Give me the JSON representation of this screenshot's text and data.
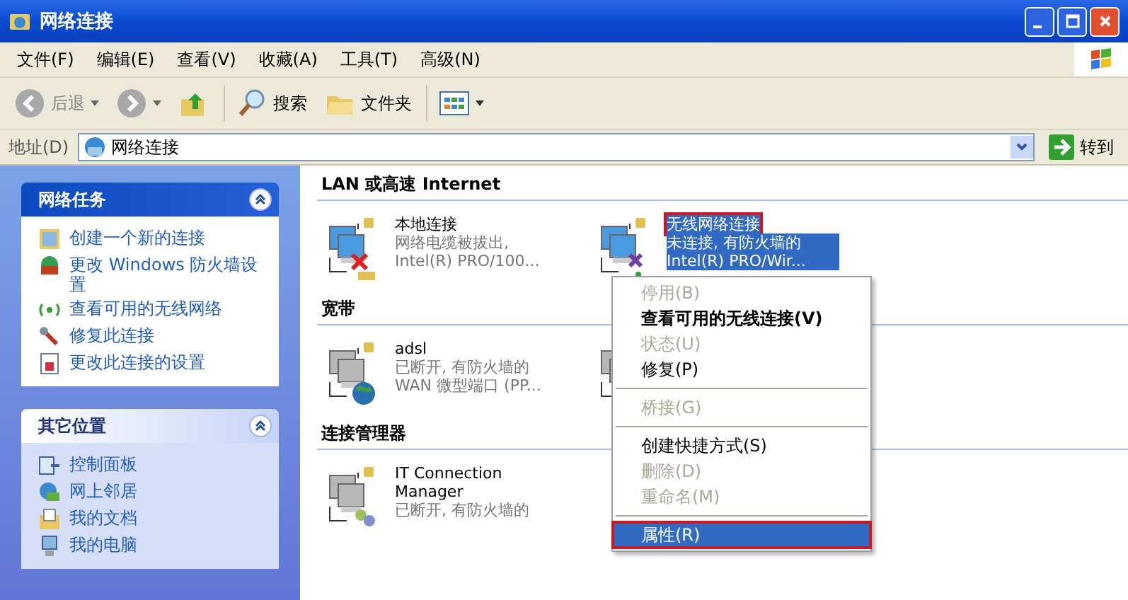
{
  "window": {
    "title": "网络连接"
  },
  "menu": [
    "文件(F)",
    "编辑(E)",
    "查看(V)",
    "收藏(A)",
    "工具(T)",
    "高级(N)"
  ],
  "toolbar": [
    {
      "kind": "back",
      "label": "后退",
      "disabled": true
    },
    {
      "kind": "forward",
      "disabled": true
    },
    {
      "kind": "up"
    },
    {
      "kind": "search",
      "label": "搜索"
    },
    {
      "kind": "folders",
      "label": "文件夹"
    },
    {
      "kind": "views"
    }
  ],
  "address": {
    "label": "地址(D)",
    "value": "网络连接",
    "go": "转到"
  },
  "sidebar": {
    "panels": [
      {
        "title": "网络任务",
        "items": [
          "创建一个新的连接",
          "更改 Windows 防火墙设置",
          "查看可用的无线网络",
          "修复此连接",
          "更改此连接的设置"
        ]
      },
      {
        "title": "其它位置",
        "items": [
          "控制面板",
          "网上邻居",
          "我的文档",
          "我的电脑"
        ]
      }
    ]
  },
  "groups": [
    {
      "title": "LAN 或高速 Internet",
      "items": [
        {
          "name": "本地连接",
          "lines": [
            "网络电缆被拔出,",
            "Intel(R) PRO/100..."
          ],
          "selected": false,
          "annotated": false
        },
        {
          "name": "无线网络连接",
          "lines": [
            "未连接, 有防火墙的",
            "Intel(R) PRO/Wir..."
          ],
          "selected": true,
          "annotated": true
        }
      ]
    },
    {
      "title": "宽带",
      "items": [
        {
          "name": "adsl",
          "lines": [
            "已断开, 有防火墙的",
            "WAN 微型端口 (PP..."
          ],
          "selected": false,
          "annotated": false
        },
        {
          "selected": false,
          "annotated": false
        }
      ]
    },
    {
      "title": "连接管理器",
      "items": [
        {
          "name": "IT Connection Manager",
          "lines": [
            "已断开, 有防火墙的"
          ],
          "selected": false,
          "annotated": false
        }
      ]
    }
  ],
  "context_menu": [
    {
      "kind": "item",
      "label": "停用(B)",
      "disabled": true,
      "default": false,
      "selected": false,
      "annotated": false
    },
    {
      "kind": "item",
      "label": "查看可用的无线连接(V)",
      "disabled": false,
      "default": true,
      "selected": false,
      "annotated": false
    },
    {
      "kind": "item",
      "label": "状态(U)",
      "disabled": true,
      "default": false,
      "selected": false,
      "annotated": false
    },
    {
      "kind": "item",
      "label": "修复(P)",
      "disabled": false,
      "default": false,
      "selected": false,
      "annotated": false
    },
    {
      "kind": "separator"
    },
    {
      "kind": "item",
      "label": "桥接(G)",
      "disabled": true,
      "default": false,
      "selected": false,
      "annotated": false
    },
    {
      "kind": "separator"
    },
    {
      "kind": "item",
      "label": "创建快捷方式(S)",
      "disabled": false,
      "default": false,
      "selected": false,
      "annotated": false
    },
    {
      "kind": "item",
      "label": "删除(D)",
      "disabled": true,
      "default": false,
      "selected": false,
      "annotated": false
    },
    {
      "kind": "item",
      "label": "重命名(M)",
      "disabled": true,
      "default": false,
      "selected": false,
      "annotated": false
    },
    {
      "kind": "separator"
    },
    {
      "kind": "item",
      "label": "属性(R)",
      "disabled": false,
      "default": false,
      "selected": true,
      "annotated": true
    }
  ]
}
